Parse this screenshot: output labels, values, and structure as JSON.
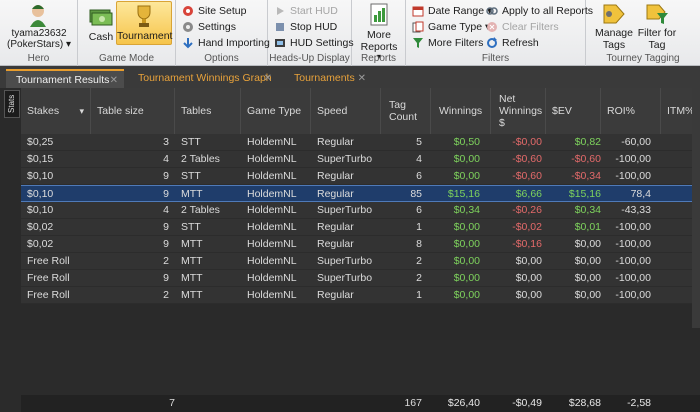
{
  "hero": {
    "name": "tyama23632",
    "site": "(PokerStars)",
    "group": "Hero"
  },
  "game_mode": {
    "cash": "Cash",
    "tournament": "Tournament",
    "group": "Game Mode"
  },
  "options": {
    "site_setup": "Site Setup",
    "settings": "Settings",
    "hand_importing": "Hand Importing",
    "group": "Options"
  },
  "hud": {
    "start": "Start HUD",
    "stop": "Stop HUD",
    "settings": "HUD Settings",
    "group": "Heads-Up Display"
  },
  "reports": {
    "more": "More Reports",
    "group": "Reports"
  },
  "filters": {
    "date_range": "Date Range",
    "game_type": "Game Type",
    "more": "More Filters",
    "apply_all": "Apply to all Reports",
    "clear": "Clear Filters",
    "refresh": "Refresh",
    "group": "Filters"
  },
  "tagging": {
    "manage": "Manage Tags",
    "filter": "Filter for Tag",
    "group": "Tourney Tagging"
  },
  "tabs": [
    {
      "label": "Tournament Results"
    },
    {
      "label": "Tournament Winnings Graph"
    },
    {
      "label": "Tournaments"
    }
  ],
  "stats_label": "Stats",
  "columns": [
    "Stakes",
    "Table size",
    "Tables",
    "Game Type",
    "Speed",
    "Tag Count",
    "Winnings",
    "Net Winnings $",
    "$EV",
    "ROI%",
    "ITM%"
  ],
  "rows": [
    [
      "$0,25",
      "3",
      "STT",
      "HoldemNL",
      "Regular",
      "5",
      "$0,50",
      "-$0,00",
      "$0,82",
      "-60,00"
    ],
    [
      "$0,15",
      "4",
      "2 Tables",
      "HoldemNL",
      "SuperTurbo",
      "4",
      "$0,00",
      "-$0,60",
      "-$0,60",
      "-100,00"
    ],
    [
      "$0,10",
      "9",
      "STT",
      "HoldemNL",
      "Regular",
      "6",
      "$0,00",
      "-$0,60",
      "-$0,34",
      "-100,00"
    ],
    [
      "$0,10",
      "9",
      "MTT",
      "HoldemNL",
      "Regular",
      "85",
      "$15,16",
      "$6,66",
      "$15,16",
      "78,4"
    ],
    [
      "$0,10",
      "4",
      "2 Tables",
      "HoldemNL",
      "SuperTurbo",
      "6",
      "$0,34",
      "-$0,26",
      "$0,34",
      "-43,33"
    ],
    [
      "$0,02",
      "9",
      "STT",
      "HoldemNL",
      "Regular",
      "1",
      "$0,00",
      "-$0,02",
      "$0,01",
      "-100,00"
    ],
    [
      "$0,02",
      "9",
      "MTT",
      "HoldemNL",
      "Regular",
      "8",
      "$0,00",
      "-$0,16",
      "$0,00",
      "-100,00"
    ],
    [
      "Free Roll",
      "2",
      "MTT",
      "HoldemNL",
      "SuperTurbo",
      "2",
      "$0,00",
      "$0,00",
      "$0,00",
      "-100,00"
    ],
    [
      "Free Roll",
      "9",
      "MTT",
      "HoldemNL",
      "SuperTurbo",
      "2",
      "$0,00",
      "$0,00",
      "$0,00",
      "-100,00"
    ],
    [
      "Free Roll",
      "2",
      "MTT",
      "HoldemNL",
      "Regular",
      "1",
      "$0,00",
      "$0,00",
      "$0,00",
      "-100,00"
    ]
  ],
  "totals": {
    "table_size": "7",
    "tag_count": "167",
    "winnings": "$26,40",
    "net": "-$0,49",
    "ev": "$28,68",
    "roi": "-2,58"
  },
  "colors": {
    "positive": "#7ed35d",
    "negative": "#e36a6a",
    "selected_row": "#1f3d6b",
    "accent": "#e89d2d"
  }
}
